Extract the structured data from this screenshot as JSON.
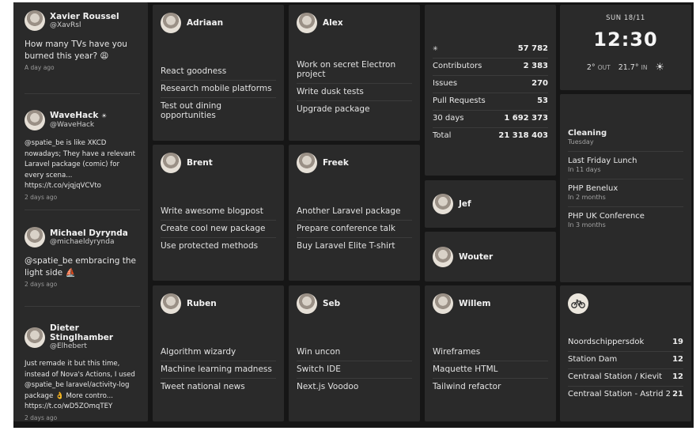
{
  "tweets": [
    {
      "name": "Xavier Roussel",
      "handle": "@XavRsl",
      "text": "How many TVs have you burned this year? 😩",
      "date": "A day ago"
    },
    {
      "name": "WaveHack",
      "handle": "@WaveHack",
      "badge": "☀",
      "text": "@spatie_be is like XKCD nowadays; They have a relevant Laravel package (comic) for every scena... https://t.co/vjqjqVCVto",
      "date": "2 days ago"
    },
    {
      "name": "Michael Dyrynda",
      "handle": "@michaeldyrynda",
      "text": "@spatie_be embracing the light side ⛵",
      "date": "2 days ago"
    },
    {
      "name": "Dieter Stinglhamber",
      "handle": "@Elhebert",
      "text": "Just remade it but this time, instead of Nova's Actions, I used @spatie_be laravel/activity-log package 👌 More contro... https://t.co/wD5ZOmqTEY",
      "date": "2 days ago"
    }
  ],
  "team": {
    "adriaan": {
      "name": "Adriaan",
      "tasks": [
        "React goodness",
        "Research mobile platforms",
        "Test out dining opportunities"
      ]
    },
    "alex": {
      "name": "Alex",
      "tasks": [
        "Work on secret Electron project",
        "Write dusk tests",
        "Upgrade package"
      ]
    },
    "brent": {
      "name": "Brent",
      "tasks": [
        "Write awesome blogpost",
        "Create cool new package",
        "Use protected methods"
      ]
    },
    "freek": {
      "name": "Freek",
      "tasks": [
        "Another Laravel package",
        "Prepare conference talk",
        "Buy Laravel Elite T-shirt"
      ]
    },
    "ruben": {
      "name": "Ruben",
      "tasks": [
        "Algorithm wizardy",
        "Machine learning madness",
        "Tweet national news"
      ]
    },
    "seb": {
      "name": "Seb",
      "tasks": [
        "Win uncon",
        "Switch IDE",
        "Next.js Voodoo"
      ]
    },
    "willem": {
      "name": "Willem",
      "tasks": [
        "Wireframes",
        "Maquette HTML",
        "Tailwind refactor"
      ]
    },
    "jef": {
      "name": "Jef"
    },
    "wouter": {
      "name": "Wouter"
    }
  },
  "stats": [
    {
      "label": "✳",
      "value": "57 782"
    },
    {
      "label": "Contributors",
      "value": "2 383"
    },
    {
      "label": "Issues",
      "value": "270"
    },
    {
      "label": "Pull Requests",
      "value": "53"
    },
    {
      "label": "30 days",
      "value": "1 692 373"
    },
    {
      "label": "Total",
      "value": "21 318 403"
    }
  ],
  "clock": {
    "date": "SUN 18/11",
    "time": "12:30",
    "out_temp": "2°",
    "out_label": "OUT",
    "in_temp": "21.7°",
    "in_label": "IN",
    "weather_icon": "☀"
  },
  "events": [
    {
      "title": "Cleaning",
      "sub": "Tuesday"
    },
    {
      "title": "Last Friday Lunch",
      "sub": "In 11 days"
    },
    {
      "title": "PHP Benelux",
      "sub": "In 2 months"
    },
    {
      "title": "PHP UK Conference",
      "sub": "In 3 months"
    }
  ],
  "bikes": {
    "icon": "bicycle-icon",
    "stations": [
      {
        "name": "Noordschippersdok",
        "count": "19"
      },
      {
        "name": "Station Dam",
        "count": "12"
      },
      {
        "name": "Centraal Station / Kievit",
        "count": "12"
      },
      {
        "name": "Centraal Station - Astrid 2",
        "count": "21"
      }
    ]
  },
  "colors": {
    "tile": "#2a2a2a",
    "background": "#161616",
    "text": "#e8e8e8"
  }
}
